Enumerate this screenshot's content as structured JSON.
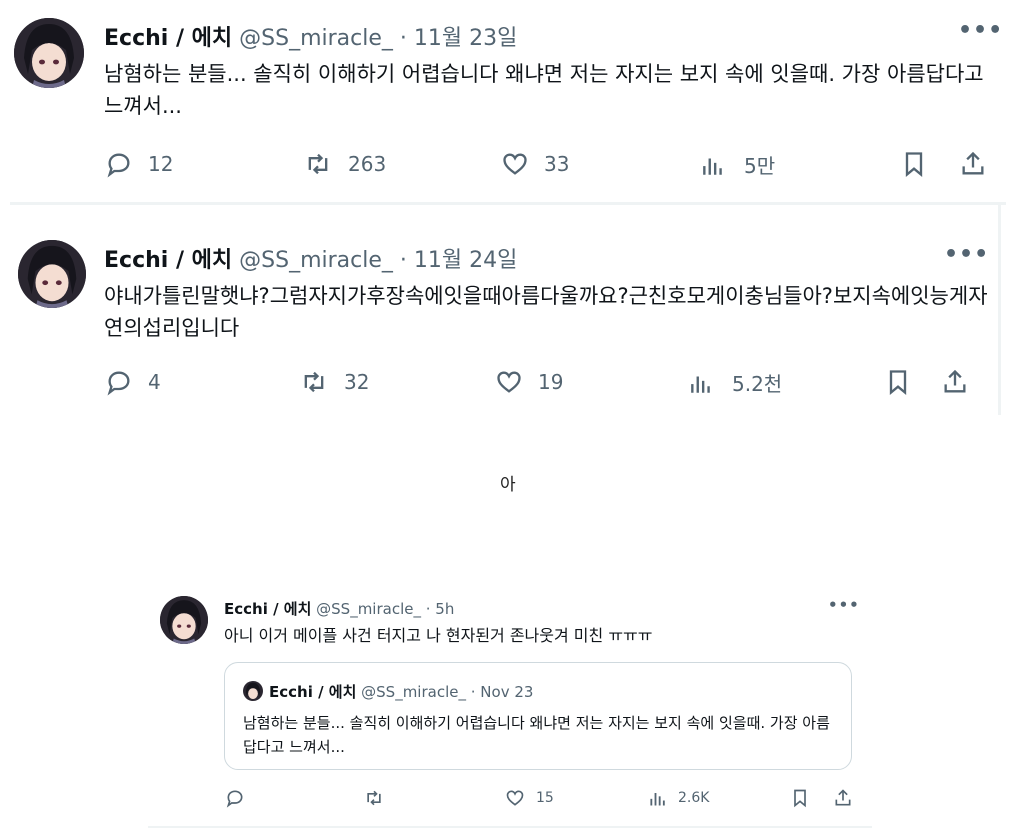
{
  "tweet1": {
    "name": "Ecchi / 에치",
    "handle": "@SS_miracle_",
    "date": "· 11월 23일",
    "text": "남혐하는 분들... 솔직히 이해하기 어렵습니다 왜냐면 저는 자지는 보지 속에 잇을때. 가장 아름답다고 느껴서...",
    "replies": "12",
    "retweets": "263",
    "likes": "33",
    "views": "5만"
  },
  "tweet2": {
    "name": "Ecchi / 에치",
    "handle": "@SS_miracle_",
    "date": "· 11월 24일",
    "text": "야내가틀린말햇냐?그럼자지가후장속에잇을때아름다울까요?근친호모게이충님들아?보지속에잇능게자연의섭리입니다",
    "replies": "4",
    "retweets": "32",
    "likes": "19",
    "views": "5.2천"
  },
  "separator_text": "아",
  "tweet3": {
    "name": "Ecchi / 에치",
    "handle": "@SS_miracle_",
    "date": "· 5h",
    "text": "아니 이거 메이플 사건 터지고 나 현자된거 존나웃겨 미친 ㅠㅠㅠ",
    "likes": "15",
    "views": "2.6K",
    "quote": {
      "name": "Ecchi / 에치",
      "handle": "@SS_miracle_",
      "date": "· Nov 23",
      "text": "남혐하는 분들... 솔직히 이해하기 어렵습니다 왜냐면 저는 자지는 보지 속에 잇을때. 가장 아름답다고 느껴서..."
    }
  },
  "icons": {
    "reply": "reply-icon",
    "retweet": "retweet-icon",
    "like": "heart-icon",
    "views": "views-icon",
    "bookmark": "bookmark-icon",
    "share": "share-icon",
    "more": "more-icon"
  },
  "colors": {
    "text": "#0f1419",
    "muted": "#536471",
    "border": "#cfd9de"
  }
}
